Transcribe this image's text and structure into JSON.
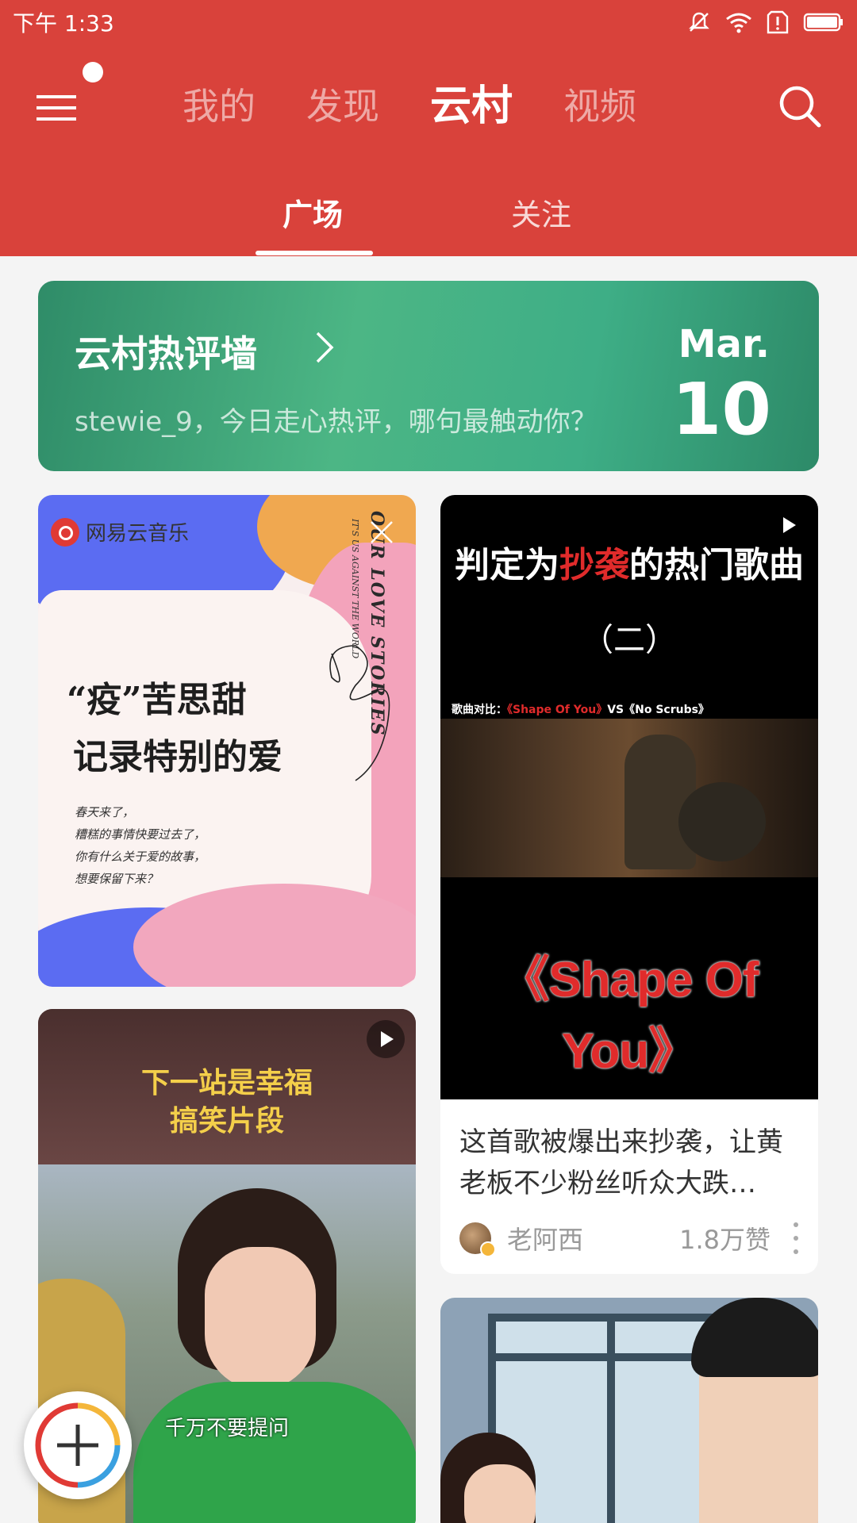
{
  "status_bar": {
    "time": "下午 1:33"
  },
  "top_nav": {
    "tabs": [
      {
        "label": "我的"
      },
      {
        "label": "发现"
      },
      {
        "label": "云村"
      },
      {
        "label": "视频"
      }
    ],
    "active_tab": "云村"
  },
  "sub_tabs": {
    "items": [
      {
        "label": "广场"
      },
      {
        "label": "关注"
      }
    ],
    "active": "广场"
  },
  "banner": {
    "title": "云村热评墙",
    "subtitle": "stewie_9，今日走心热评，哪句最触动你？",
    "month": "Mar.",
    "day": "10"
  },
  "cards": {
    "card_a": {
      "brand": "网易云音乐",
      "vertical_title": "OUR LOVE STORIES",
      "vertical_sub": "IT'S US AGAINST THE WORLD",
      "title_line1": "“疫”苦思甜",
      "title_line2": "记录特别的爱",
      "lines": [
        "春天来了，",
        "糟糕的事情快要过去了，",
        "你有什么关于爱的故事，",
        "想要保留下来？"
      ]
    },
    "card_b": {
      "headline_pre": "判定为",
      "headline_red": "抄袭",
      "headline_post": "的热门歌曲",
      "headline_sub": "（二）",
      "compare_pre": "歌曲对比：",
      "compare_red": "《Shape Of You》",
      "compare_post": "VS《No Scrubs》",
      "big_text": "《Shape Of You》",
      "caption": "这首歌被爆出来抄袭，让黄老板不少粉丝听众大跌…",
      "author": "老阿西",
      "likes": "1.8万赞"
    },
    "card_c": {
      "title_line1": "下一站是幸福",
      "title_line2": "搞笑片段",
      "subtitle": "千万不要提问"
    }
  },
  "colors": {
    "header_red": "#d9423b",
    "banner_green": "#4cb685",
    "accent_red": "#e02b2b"
  },
  "icons": {
    "menu": "menu-icon",
    "search": "search-icon",
    "add": "add-icon",
    "play": "play-icon",
    "close": "close-icon",
    "more": "more-vertical-icon"
  }
}
